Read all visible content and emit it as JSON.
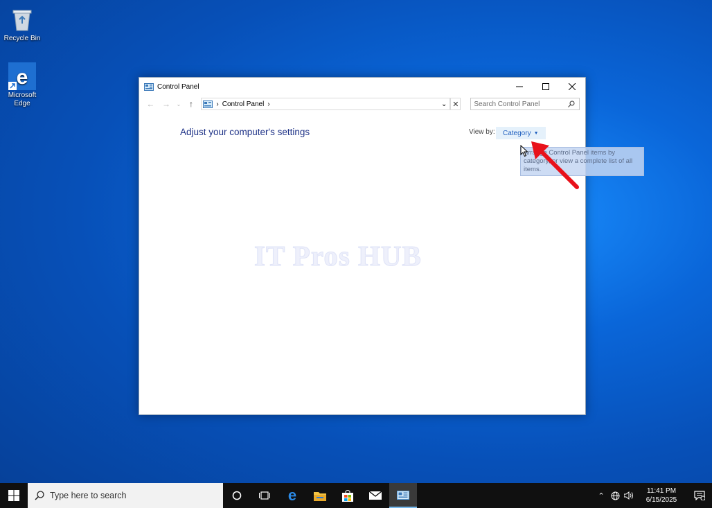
{
  "desktop": {
    "icons": [
      {
        "label": "Recycle Bin",
        "icon": "recycle-bin-icon"
      },
      {
        "label": "Microsoft Edge",
        "icon": "edge-icon"
      }
    ]
  },
  "window": {
    "title": "Control Panel",
    "address": {
      "crumb": "Control Panel"
    },
    "search_placeholder": "Search Control Panel",
    "heading": "Adjust your computer's settings",
    "view_by_label": "View by:",
    "view_by_value": "Category",
    "tooltip": "Arrange Control Panel items by category, or view a complete list of all items."
  },
  "watermark": "IT Pros HUB",
  "taskbar": {
    "search_placeholder": "Type here to search",
    "apps": [
      "task-view",
      "edge",
      "file-explorer",
      "store",
      "mail",
      "control-panel"
    ],
    "time": "11:41 PM",
    "date": "6/15/2025"
  },
  "colors": {
    "accent": "#1f5fbf",
    "heading": "#1e3287",
    "taskbar": "#101010",
    "annotation_arrow": "#e8111a"
  }
}
